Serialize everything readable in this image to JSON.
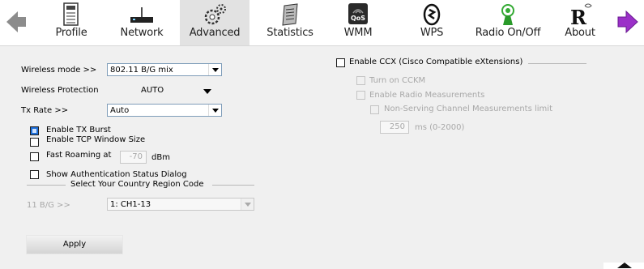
{
  "toolbar": {
    "items": [
      {
        "label": "Profile",
        "icon": "profile-icon"
      },
      {
        "label": "Network",
        "icon": "network-icon"
      },
      {
        "label": "Advanced",
        "icon": "advanced-icon"
      },
      {
        "label": "Statistics",
        "icon": "statistics-icon"
      },
      {
        "label": "WMM",
        "icon": "wmm-icon"
      },
      {
        "label": "WPS",
        "icon": "wps-icon"
      },
      {
        "label": "Radio On/Off",
        "icon": "radio-icon"
      },
      {
        "label": "About",
        "icon": "about-icon"
      }
    ],
    "active": "Advanced",
    "wmm_icon_text": "QoS",
    "about_icon_text": "R"
  },
  "left": {
    "wireless_mode_label": "Wireless mode >>",
    "wireless_mode_value": "802.11 B/G mix",
    "protection_label": "Wireless Protection",
    "protection_value": "AUTO",
    "tx_rate_label": "Tx Rate >>",
    "tx_rate_value": "Auto",
    "tx_burst_label": "Enable TX Burst",
    "tcp_window_label": "Enable TCP Window Size",
    "fast_roaming_label": "Fast Roaming at",
    "fast_roaming_value": "-70",
    "fast_roaming_unit": "dBm",
    "auth_dialog_label": "Show Authentication Status Dialog",
    "region_group_label": "Select Your Country Region Code",
    "region_band_label": "11 B/G >>",
    "region_value": "1: CH1-13",
    "apply_label": "Apply"
  },
  "right": {
    "ccx_label": "Enable CCX (Cisco Compatible eXtensions)",
    "cckm_label": "Turn on CCKM",
    "radio_meas_label": "Enable Radio Measurements",
    "nonserving_label": "Non-Serving Channel Measurements limit",
    "limit_value": "250",
    "limit_unit": "ms (0-2000)"
  },
  "colors": {
    "active_tab": "#e2e2e2",
    "panel_bg": "#f0f0f0",
    "checkbox_checked": "#1e6fd9",
    "disabled_text": "#a8a8a8",
    "back_arrow": "#888888",
    "forward_arrow": "#9b30c8"
  }
}
